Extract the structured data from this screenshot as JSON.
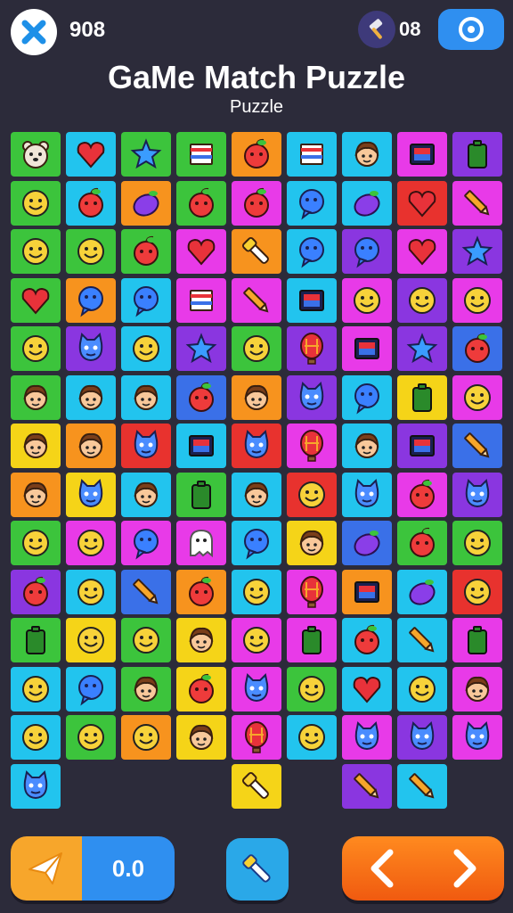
{
  "header": {
    "score": "908",
    "hammer_count": "08",
    "title": "GaMe Match Puzzle",
    "subtitle": "Puzzle"
  },
  "footer": {
    "progress_value": "0.0"
  },
  "icons": {
    "close": "close-x-icon",
    "hammer": "hammer-icon",
    "target": "target-icon",
    "paper_plane": "paper-plane-icon",
    "flashlight": "flashlight-icon",
    "arrow_left": "arrow-left-icon",
    "arrow_right": "arrow-right-icon"
  },
  "board": {
    "palette": {
      "green": "#3cc43c",
      "cyan": "#22c4ee",
      "orange": "#f7931e",
      "magenta": "#e83ae8",
      "purple": "#8a36e0",
      "blue": "#3a70e8",
      "red": "#e8322e",
      "yellow": "#f5d418"
    },
    "rows": [
      [
        {
          "c": "green",
          "i": "bear"
        },
        {
          "c": "cyan",
          "i": "heart"
        },
        {
          "c": "green",
          "i": "star"
        },
        {
          "c": "green",
          "i": "flag"
        },
        {
          "c": "orange",
          "i": "fruit"
        },
        {
          "c": "cyan",
          "i": "flag"
        },
        {
          "c": "cyan",
          "i": "face"
        },
        {
          "c": "magenta",
          "i": "frame"
        },
        {
          "c": "purple",
          "i": "battery"
        }
      ],
      [
        {
          "c": "green",
          "i": "smile"
        },
        {
          "c": "cyan",
          "i": "fruit"
        },
        {
          "c": "orange",
          "i": "berry"
        },
        {
          "c": "green",
          "i": "fruit"
        },
        {
          "c": "magenta",
          "i": "fruit"
        },
        {
          "c": "cyan",
          "i": "bubble"
        },
        {
          "c": "cyan",
          "i": "berry"
        },
        {
          "c": "red",
          "i": "heart"
        },
        {
          "c": "magenta",
          "i": "pencil"
        }
      ],
      [
        {
          "c": "green",
          "i": "smile"
        },
        {
          "c": "green",
          "i": "smile"
        },
        {
          "c": "green",
          "i": "fruit"
        },
        {
          "c": "magenta",
          "i": "heart"
        },
        {
          "c": "orange",
          "i": "flashlight"
        },
        {
          "c": "cyan",
          "i": "bubble"
        },
        {
          "c": "purple",
          "i": "bubble"
        },
        {
          "c": "magenta",
          "i": "heart"
        },
        {
          "c": "purple",
          "i": "star"
        }
      ],
      [
        {
          "c": "green",
          "i": "heart"
        },
        {
          "c": "orange",
          "i": "bubble"
        },
        {
          "c": "cyan",
          "i": "bubble"
        },
        {
          "c": "magenta",
          "i": "flag"
        },
        {
          "c": "magenta",
          "i": "pencil"
        },
        {
          "c": "cyan",
          "i": "frame"
        },
        {
          "c": "magenta",
          "i": "smile"
        },
        {
          "c": "purple",
          "i": "smile"
        },
        {
          "c": "magenta",
          "i": "smile"
        }
      ],
      [
        {
          "c": "green",
          "i": "smile"
        },
        {
          "c": "purple",
          "i": "monster"
        },
        {
          "c": "cyan",
          "i": "smile"
        },
        {
          "c": "purple",
          "i": "star"
        },
        {
          "c": "green",
          "i": "smile"
        },
        {
          "c": "purple",
          "i": "balloon"
        },
        {
          "c": "magenta",
          "i": "frame"
        },
        {
          "c": "purple",
          "i": "star"
        },
        {
          "c": "blue",
          "i": "fruit"
        }
      ],
      [
        {
          "c": "green",
          "i": "face"
        },
        {
          "c": "cyan",
          "i": "face"
        },
        {
          "c": "cyan",
          "i": "face"
        },
        {
          "c": "blue",
          "i": "fruit"
        },
        {
          "c": "orange",
          "i": "face"
        },
        {
          "c": "purple",
          "i": "monster"
        },
        {
          "c": "cyan",
          "i": "bubble"
        },
        {
          "c": "yellow",
          "i": "battery"
        },
        {
          "c": "magenta",
          "i": "smile"
        }
      ],
      [
        {
          "c": "yellow",
          "i": "face"
        },
        {
          "c": "orange",
          "i": "face"
        },
        {
          "c": "red",
          "i": "monster"
        },
        {
          "c": "cyan",
          "i": "frame"
        },
        {
          "c": "red",
          "i": "monster"
        },
        {
          "c": "magenta",
          "i": "balloon"
        },
        {
          "c": "cyan",
          "i": "face"
        },
        {
          "c": "purple",
          "i": "frame"
        },
        {
          "c": "blue",
          "i": "pencil"
        }
      ],
      [
        {
          "c": "orange",
          "i": "face"
        },
        {
          "c": "yellow",
          "i": "monster"
        },
        {
          "c": "cyan",
          "i": "face"
        },
        {
          "c": "green",
          "i": "battery"
        },
        {
          "c": "cyan",
          "i": "face"
        },
        {
          "c": "red",
          "i": "smile"
        },
        {
          "c": "cyan",
          "i": "monster"
        },
        {
          "c": "magenta",
          "i": "fruit"
        },
        {
          "c": "purple",
          "i": "monster"
        }
      ],
      [
        {
          "c": "green",
          "i": "smile"
        },
        {
          "c": "magenta",
          "i": "smile"
        },
        {
          "c": "magenta",
          "i": "bubble"
        },
        {
          "c": "magenta",
          "i": "ghost"
        },
        {
          "c": "cyan",
          "i": "bubble"
        },
        {
          "c": "yellow",
          "i": "face"
        },
        {
          "c": "blue",
          "i": "berry"
        },
        {
          "c": "green",
          "i": "fruit"
        },
        {
          "c": "green",
          "i": "smile"
        }
      ],
      [
        {
          "c": "purple",
          "i": "fruit"
        },
        {
          "c": "cyan",
          "i": "smile"
        },
        {
          "c": "blue",
          "i": "pencil"
        },
        {
          "c": "orange",
          "i": "fruit"
        },
        {
          "c": "cyan",
          "i": "smile"
        },
        {
          "c": "magenta",
          "i": "balloon"
        },
        {
          "c": "orange",
          "i": "frame"
        },
        {
          "c": "cyan",
          "i": "berry"
        },
        {
          "c": "red",
          "i": "smile"
        }
      ],
      [
        {
          "c": "green",
          "i": "battery"
        },
        {
          "c": "yellow",
          "i": "smile"
        },
        {
          "c": "green",
          "i": "smile"
        },
        {
          "c": "yellow",
          "i": "face"
        },
        {
          "c": "magenta",
          "i": "smile"
        },
        {
          "c": "magenta",
          "i": "battery"
        },
        {
          "c": "cyan",
          "i": "fruit"
        },
        {
          "c": "cyan",
          "i": "pencil"
        },
        {
          "c": "magenta",
          "i": "battery"
        }
      ],
      [
        {
          "c": "cyan",
          "i": "smile"
        },
        {
          "c": "cyan",
          "i": "bubble"
        },
        {
          "c": "green",
          "i": "face"
        },
        {
          "c": "yellow",
          "i": "fruit"
        },
        {
          "c": "magenta",
          "i": "monster"
        },
        {
          "c": "green",
          "i": "smile"
        },
        {
          "c": "cyan",
          "i": "heart"
        },
        {
          "c": "cyan",
          "i": "smile"
        },
        {
          "c": "magenta",
          "i": "face"
        }
      ],
      [
        {
          "c": "cyan",
          "i": "smile"
        },
        {
          "c": "green",
          "i": "smile"
        },
        {
          "c": "orange",
          "i": "smile"
        },
        {
          "c": "yellow",
          "i": "face"
        },
        {
          "c": "magenta",
          "i": "balloon"
        },
        {
          "c": "cyan",
          "i": "smile"
        },
        {
          "c": "magenta",
          "i": "monster"
        },
        {
          "c": "purple",
          "i": "monster"
        },
        {
          "c": "magenta",
          "i": "monster"
        }
      ],
      [
        {
          "c": "cyan",
          "i": "monster"
        },
        null,
        null,
        null,
        {
          "c": "yellow",
          "i": "flashlight"
        },
        null,
        {
          "c": "purple",
          "i": "pencil"
        },
        {
          "c": "cyan",
          "i": "pencil"
        },
        null
      ]
    ]
  }
}
